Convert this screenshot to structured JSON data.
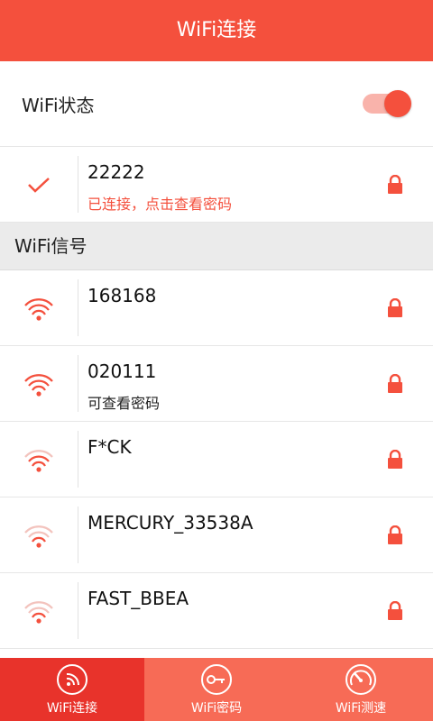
{
  "header": {
    "title": "WiFi连接"
  },
  "status": {
    "label": "WiFi状态",
    "enabled": true
  },
  "connected": {
    "ssid": "22222",
    "note": "已连接，点击查看密码"
  },
  "section": {
    "title": "WiFi信号"
  },
  "networks": [
    {
      "ssid": "168168",
      "note": "",
      "signal": 3
    },
    {
      "ssid": "020111",
      "note": "可查看密码",
      "signal": 3
    },
    {
      "ssid": "F*CK",
      "note": "",
      "signal": 2
    },
    {
      "ssid": "MERCURY_33538A",
      "note": "",
      "signal": 1
    },
    {
      "ssid": "FAST_BBEA",
      "note": "",
      "signal": 1
    }
  ],
  "tabs": [
    {
      "label": "WiFi连接",
      "icon": "wifi-circle-icon",
      "active": true
    },
    {
      "label": "WiFi密码",
      "icon": "key-circle-icon",
      "active": false
    },
    {
      "label": "WiFi测速",
      "icon": "speedometer-icon",
      "active": false
    }
  ],
  "colors": {
    "accent": "#f4503d",
    "accent_dark": "#e8332b",
    "tab_bg": "#f76b56",
    "faded": "#f3c3bd"
  }
}
